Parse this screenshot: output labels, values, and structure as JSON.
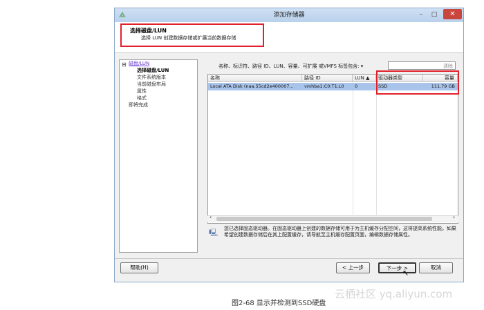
{
  "window": {
    "title": "添加存储器",
    "minimize": "–",
    "maximize": "□",
    "close": "✕"
  },
  "header": {
    "title": "选择磁盘/LUN",
    "subtitle": "选择 LUN 创建数据存储或扩展当前数据存储"
  },
  "nav": [
    {
      "label": "磁盘/LUN",
      "state": "link"
    },
    {
      "label": "选择磁盘/LUN",
      "state": "current"
    },
    {
      "label": "文件系统版本",
      "state": "normal"
    },
    {
      "label": "当前磁盘布局",
      "state": "normal"
    },
    {
      "label": "属性",
      "state": "normal"
    },
    {
      "label": "格式",
      "state": "normal"
    },
    {
      "label": "即将完成",
      "state": "normal"
    }
  ],
  "filter": {
    "label": "名称、标识符、路径 ID、LUN、容量、可扩展 或VMFS 标签包含: ▾",
    "value": "",
    "clear": "清除"
  },
  "table": {
    "columns": [
      "名称",
      "路径 ID",
      "LUN ▲",
      "驱动器类型",
      "容量"
    ],
    "rows": [
      [
        "Local ATA Disk (naa.55cd2e400007...",
        "vmhba1:C0:T1:L0",
        "0",
        "SSD",
        "111.79 GB"
      ]
    ]
  },
  "info": "您已选择固态驱动器。在固态驱动器上创建的数据存储可用于为主机缓存分配空间，这将提高系统性能。如果希望创建数据存储后在其上配置缓存，请导航至主机缓存配置页面，编辑数据存储属性。",
  "buttons": {
    "help": "帮助(H)",
    "back": "< 上一步",
    "next": "下一步 >",
    "cancel": "取消"
  },
  "watermark": "云栖社区 yq.aliyun.com",
  "caption": "图2-68  显示并检测到SSD硬盘",
  "colors": {
    "highlight": "#e0202a",
    "selected_row": "#a9c4ea",
    "link": "#6a3bd6"
  }
}
